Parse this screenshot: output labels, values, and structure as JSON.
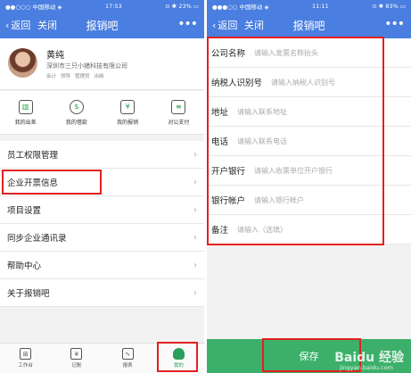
{
  "left": {
    "status": {
      "carrier": "●●○○○ 中国移动 ◈",
      "time": "17:53",
      "battery": "⊙ ✱ 23% ▭"
    },
    "nav": {
      "back": "返回",
      "close": "关闭",
      "title": "报销吧",
      "more": "•••"
    },
    "profile": {
      "name": "黄纯",
      "company": "深圳市三只小猪科技有限公司",
      "roles": [
        "会计",
        "领导",
        "管理员",
        "出纳"
      ]
    },
    "quick_actions": [
      {
        "label": "我的出差",
        "icon": "luggage-icon",
        "glyph": "▥"
      },
      {
        "label": "我的借款",
        "icon": "loan-icon",
        "glyph": "$"
      },
      {
        "label": "我的报销",
        "icon": "reimburse-icon",
        "glyph": "¥"
      },
      {
        "label": "对公支付",
        "icon": "payment-icon",
        "glyph": "≡"
      }
    ],
    "menu": [
      {
        "label": "员工权限管理"
      },
      {
        "label": "企业开票信息"
      },
      {
        "label": "项目设置"
      },
      {
        "label": "同步企业通讯录"
      },
      {
        "label": "帮助中心"
      },
      {
        "label": "关于报销吧"
      }
    ],
    "tabs": [
      {
        "label": "工作台",
        "icon": "grid-icon",
        "glyph": "⊞"
      },
      {
        "label": "记账",
        "icon": "ledger-icon",
        "glyph": "¥"
      },
      {
        "label": "报表",
        "icon": "chart-icon",
        "glyph": "∿"
      },
      {
        "label": "我的",
        "icon": "profile-icon",
        "glyph": ""
      }
    ]
  },
  "right": {
    "status": {
      "carrier": "●●●○○ 中国移动 ◈",
      "time": "11:11",
      "battery": "⊙ ✱ 83% ▭"
    },
    "nav": {
      "back": "返回",
      "close": "关闭",
      "title": "报销吧",
      "more": "•••"
    },
    "form": [
      {
        "label": "公司名称",
        "placeholder": "请输入发票名称抬头"
      },
      {
        "label": "纳税人识别号",
        "placeholder": "请输入纳税人识别号"
      },
      {
        "label": "地址",
        "placeholder": "请输入联系地址"
      },
      {
        "label": "电话",
        "placeholder": "请输入联系电话"
      },
      {
        "label": "开户银行",
        "placeholder": "请输入收票单位开户银行"
      },
      {
        "label": "银行帐户",
        "placeholder": "请输入银行帐户"
      },
      {
        "label": "备注",
        "placeholder": "请输入（选填）"
      }
    ],
    "save": "保存",
    "watermark": "Baidu 经验",
    "watermark_sub": "jingyan.baidu.com"
  },
  "colors": {
    "nav_blue": "#4a7ee0",
    "accent_green": "#3cb06a",
    "highlight_red": "#e32020"
  }
}
